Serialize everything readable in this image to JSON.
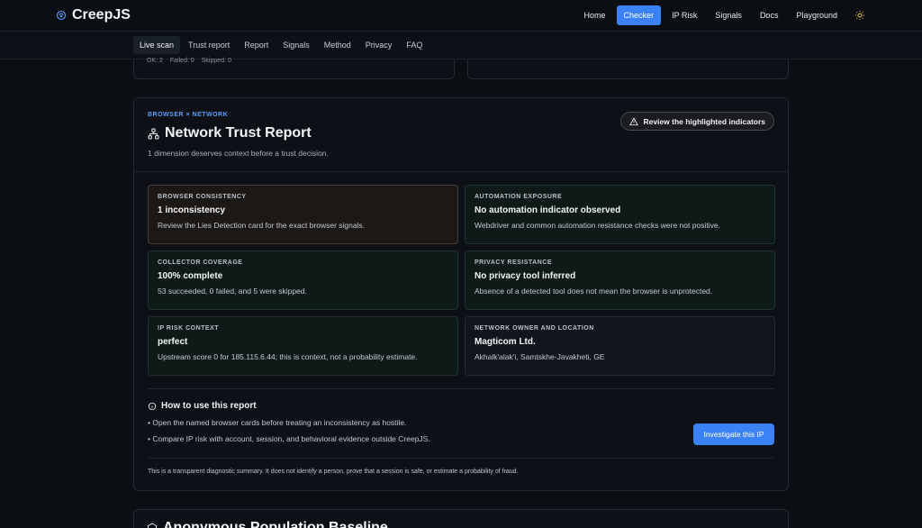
{
  "brand": {
    "name": "CreepJS",
    "logo_icon": "shield-icon"
  },
  "nav": [
    {
      "label": "Home",
      "active": false
    },
    {
      "label": "Checker",
      "active": true
    },
    {
      "label": "IP Risk",
      "active": false
    },
    {
      "label": "Signals",
      "active": false
    },
    {
      "label": "Docs",
      "active": false
    },
    {
      "label": "Playground",
      "active": false
    }
  ],
  "theme_toggle_icon": "sun-icon",
  "subnav": [
    {
      "label": "Live scan",
      "active": true
    },
    {
      "label": "Trust report",
      "active": false
    },
    {
      "label": "Report",
      "active": false
    },
    {
      "label": "Signals",
      "active": false
    },
    {
      "label": "Method",
      "active": false
    },
    {
      "label": "Privacy",
      "active": false
    },
    {
      "label": "FAQ",
      "active": false
    }
  ],
  "prev_card": {
    "ok": "OK: 2",
    "failed": "Failed: 0",
    "skipped": "Skipped: 0"
  },
  "report": {
    "kicker": "BROWSER × NETWORK",
    "title": "Network Trust Report",
    "subtitle": "1 dimension deserves context before a trust decision.",
    "review_button": "Review the highlighted indicators",
    "tiles": [
      {
        "label": "BROWSER CONSISTENCY",
        "value": "1 inconsistency",
        "desc": "Review the Lies Detection card for the exact browser signals.",
        "status": "warn"
      },
      {
        "label": "AUTOMATION EXPOSURE",
        "value": "No automation indicator observed",
        "desc": "Webdriver and common automation resistance checks were not positive.",
        "status": "ok"
      },
      {
        "label": "COLLECTOR COVERAGE",
        "value": "100% complete",
        "desc": "53 succeeded, 0 failed, and 5 were skipped.",
        "status": "ok"
      },
      {
        "label": "PRIVACY RESISTANCE",
        "value": "No privacy tool inferred",
        "desc": "Absence of a detected tool does not mean the browser is unprotected.",
        "status": "ok"
      },
      {
        "label": "IP RISK CONTEXT",
        "value": "perfect",
        "desc": "Upstream score 0 for 185.115.6.44; this is context, not a probability estimate.",
        "status": "ok"
      },
      {
        "label": "NETWORK OWNER AND LOCATION",
        "value": "Magticom Ltd.",
        "desc": "Akhalk'alak'i, Samtskhe-Javakheti, GE",
        "status": "neutral"
      }
    ],
    "howto": {
      "title": "How to use this report",
      "items": [
        "• Open the named browser cards before treating an inconsistency as hostile.",
        "• Compare IP risk with account, session, and behavioral evidence outside CreepJS."
      ]
    },
    "investigate_button": "Investigate this IP",
    "disclaimer": "This is a transparent diagnostic summary. It does not identify a person, prove that a session is safe, or estimate a probability of fraud."
  },
  "next_section": {
    "title": "Anonymous Population Baseline"
  }
}
